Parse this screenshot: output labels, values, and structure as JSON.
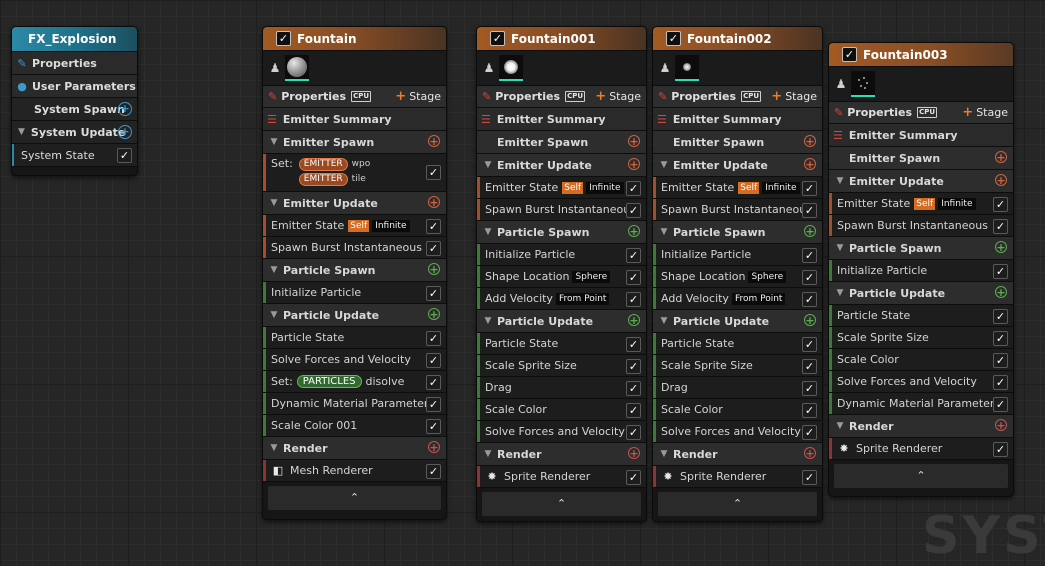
{
  "watermark": "SYST",
  "system": {
    "title": "FX_Explosion",
    "properties": "Properties",
    "user_parameters": "User Parameters",
    "system_spawn": "System Spawn",
    "system_update": "System Update",
    "system_state": "System State"
  },
  "common": {
    "properties": "Properties",
    "cpu": "CPU",
    "stage": "Stage",
    "emitter_summary": "Emitter Summary",
    "emitter_spawn": "Emitter Spawn",
    "emitter_update": "Emitter Update",
    "particle_spawn": "Particle Spawn",
    "particle_update": "Particle Update",
    "render": "Render",
    "emitter_state": "Emitter State",
    "self": "Self",
    "infinite": "Infinite",
    "spawn_burst": "Spawn Burst Instantaneous",
    "initialize_particle": "Initialize Particle",
    "shape_location": "Shape Location",
    "sphere": "Sphere",
    "add_velocity": "Add Velocity",
    "from_point": "From Point",
    "particle_state": "Particle State",
    "scale_sprite_size": "Scale Sprite Size",
    "drag": "Drag",
    "scale_color": "Scale Color",
    "solve_forces": "Solve Forces and Velocity",
    "dynamic_material": "Dynamic Material Parameters",
    "sprite_renderer": "Sprite Renderer",
    "collapse": "⌃"
  },
  "fountain": {
    "title": "Fountain",
    "set": "Set:",
    "emitter_pill": "EMITTER",
    "wpo": "wpo",
    "tile": "tile",
    "particles_pill": "PARTICLES",
    "disolve": "disolve",
    "scale_color_001": "Scale Color 001",
    "mesh_renderer": "Mesh Renderer"
  },
  "fountain001": {
    "title": "Fountain001"
  },
  "fountain002": {
    "title": "Fountain002"
  },
  "fountain003": {
    "title": "Fountain003"
  },
  "colors": {
    "emitter_header": "#a35a23",
    "system_header": "#2b8aa6",
    "emitter_stage": "#a34d29",
    "particle_stage": "#3c7a38",
    "render_stage": "#8a3434"
  }
}
